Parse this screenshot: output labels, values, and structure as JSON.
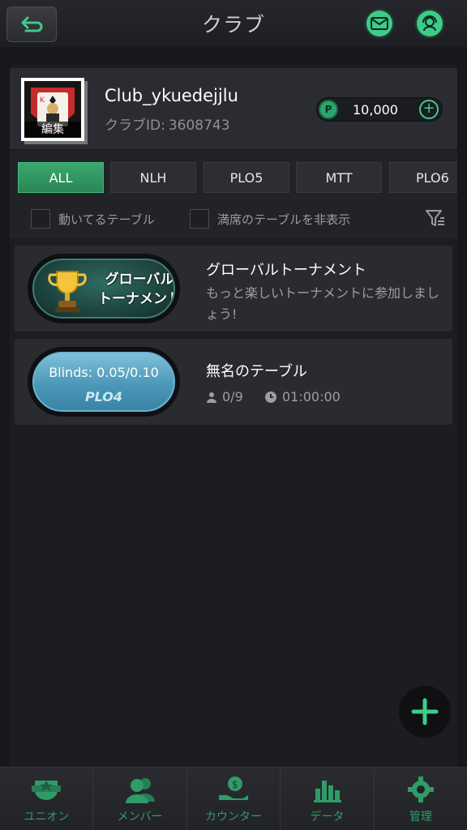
{
  "header": {
    "title": "クラブ"
  },
  "club": {
    "name": "Club_ykuedejjlu",
    "id_label": "クラブID:",
    "id_value": "3608743",
    "avatar_edit": "編集",
    "chips_badge": "P",
    "chips_amount": "10,000"
  },
  "tabs": [
    {
      "label": "ALL",
      "active": true
    },
    {
      "label": "NLH"
    },
    {
      "label": "PLO5"
    },
    {
      "label": "MTT"
    },
    {
      "label": "PLO6"
    }
  ],
  "filters": {
    "active_tables": "動いてるテーブル",
    "hide_full": "満席のテーブルを非表示"
  },
  "items": [
    {
      "badge_text_line1": "グローバル",
      "badge_text_line2": "トーナメント",
      "title": "グローバルトーナメント",
      "desc": "もっと楽しいトーナメントに参加しましょう!"
    },
    {
      "blinds": "Blinds: 0.05/0.10",
      "game_type": "PLO4",
      "title": "無名のテーブル",
      "players": "0/9",
      "time": "01:00:00"
    }
  ],
  "nav": [
    {
      "label": "ユニオン",
      "icon": "union-icon"
    },
    {
      "label": "メンバー",
      "icon": "members-icon"
    },
    {
      "label": "カウンター",
      "icon": "counter-icon"
    },
    {
      "label": "データ",
      "icon": "data-icon"
    },
    {
      "label": "管理",
      "icon": "settings-icon"
    }
  ],
  "colors": {
    "accent": "#3ecb8a",
    "nav": "#2f9c68",
    "bg": "#17181c"
  }
}
